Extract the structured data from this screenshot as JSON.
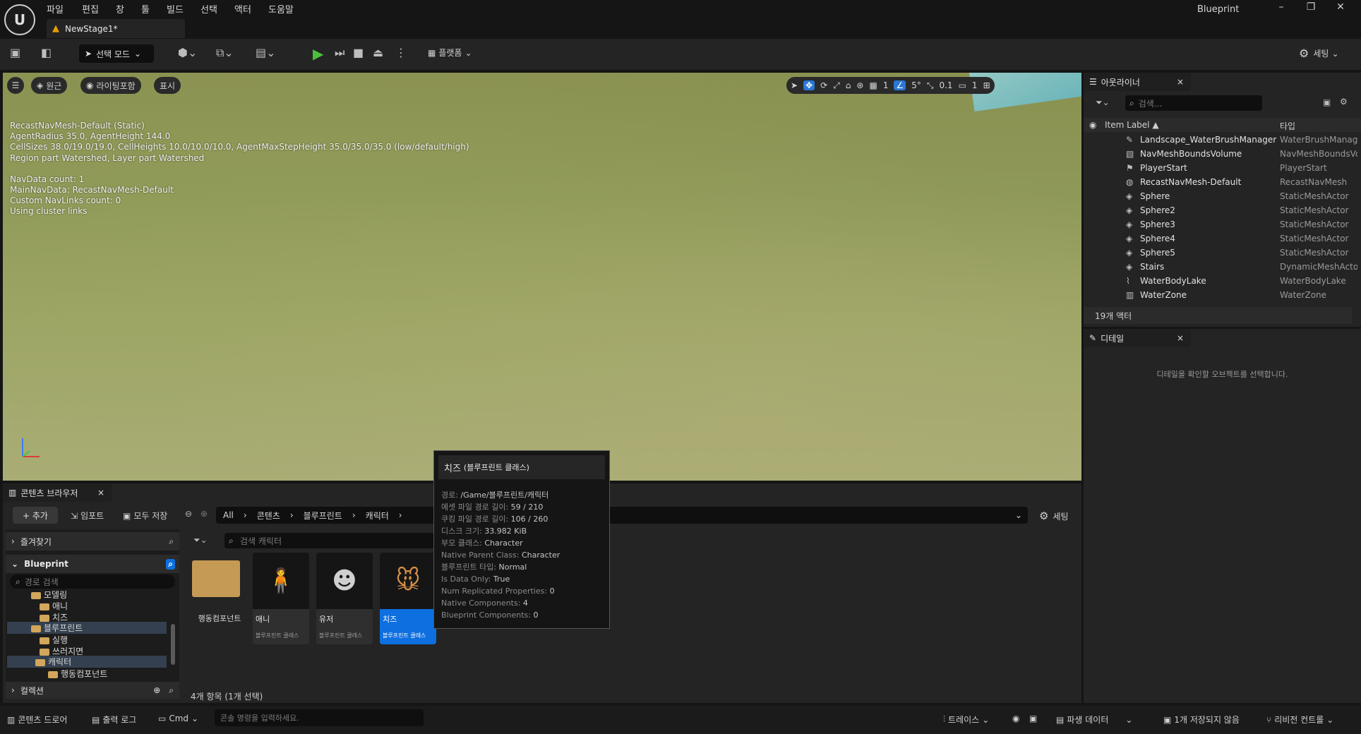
{
  "titlebar": {
    "menus": [
      "파일",
      "편집",
      "창",
      "툴",
      "빌드",
      "선택",
      "액터",
      "도움말"
    ],
    "app_name": "Blueprint",
    "minimize": "–",
    "restore": "❐",
    "close": "✕"
  },
  "tab": {
    "name": "NewStage1*"
  },
  "toolbar": {
    "mode_label": "선택 모드",
    "platform_label": "플랫폼",
    "settings_label": "세팅"
  },
  "viewport": {
    "perspective_label": "원근",
    "lighting_label": "라이팅포함",
    "show_label": "표시",
    "grid_value": "1",
    "angle_value": "5°",
    "scale_value": "0.1",
    "camera_value": "1",
    "navmesh_lines": [
      "RecastNavMesh-Default (Static)",
      "AgentRadius 35.0, AgentHeight 144.0",
      "CellSizes 38.0/19.0/19.0, CellHeights 10.0/10.0/10.0, AgentMaxStepHeight 35.0/35.0/35.0 (low/default/high)",
      "Region part Watershed, Layer part Watershed",
      "",
      "NavData count: 1",
      "MainNavData: RecastNavMesh-Default",
      "Custom NavLinks count: 0",
      "Using cluster links"
    ]
  },
  "outliner": {
    "tab_label": "아웃라이너",
    "search_placeholder": "검색...",
    "col_label": "Item Label ▲",
    "col_type": "타입",
    "rows": [
      {
        "label": "Landscape_WaterBrushManager",
        "type": "WaterBrushManager"
      },
      {
        "label": "NavMeshBoundsVolume",
        "type": "NavMeshBoundsVolume"
      },
      {
        "label": "PlayerStart",
        "type": "PlayerStart"
      },
      {
        "label": "RecastNavMesh-Default",
        "type": "RecastNavMesh"
      },
      {
        "label": "Sphere",
        "type": "StaticMeshActor"
      },
      {
        "label": "Sphere2",
        "type": "StaticMeshActor"
      },
      {
        "label": "Sphere3",
        "type": "StaticMeshActor"
      },
      {
        "label": "Sphere4",
        "type": "StaticMeshActor"
      },
      {
        "label": "Sphere5",
        "type": "StaticMeshActor"
      },
      {
        "label": "Stairs",
        "type": "DynamicMeshActor"
      },
      {
        "label": "WaterBodyLake",
        "type": "WaterBodyLake"
      },
      {
        "label": "WaterZone",
        "type": "WaterZone"
      }
    ],
    "count_label": "19개 액터"
  },
  "details": {
    "tab_label": "디테일",
    "empty_message": "디테일을 확인할 오브젝트를 선택합니다."
  },
  "content_browser": {
    "tab_label": "콘텐츠 브라우저",
    "add_label": "+ 추가",
    "import_label": "임포트",
    "save_all_label": "모두 저장",
    "path": [
      "All",
      "콘텐츠",
      "블루프린트",
      "캐릭터"
    ],
    "settings_label": "세팅",
    "favorites_label": "즐겨찾기",
    "project_label": "Blueprint",
    "path_search_placeholder": "경로 검색",
    "tree": [
      "모델링",
      "애니",
      "치즈",
      "블루프린트",
      "실행",
      "쓰러지면",
      "캐릭터",
      "행동컴포넌트"
    ],
    "collections_label": "컬렉션",
    "asset_search_placeholder": "검색 캐릭터",
    "folder_name": "행동컴포넌트",
    "assets": [
      {
        "name": "애니",
        "type": "블루프린트 클래스"
      },
      {
        "name": "유저",
        "type": "블루프린트 클래스"
      },
      {
        "name": "치즈",
        "type": "블루프린트 클래스"
      }
    ],
    "item_count": "4개 항목 (1개 선택)"
  },
  "tooltip": {
    "title": "치즈",
    "title_suffix": "(블루프린트 클래스)",
    "lines": [
      {
        "k": "경로:",
        "v": "/Game/블루프린트/캐릭터"
      },
      {
        "k": "에셋 파일 경로 길이:",
        "v": "59 / 210"
      },
      {
        "k": "쿠킹 파일 경로 길이:",
        "v": "106 / 260"
      },
      {
        "k": "디스크 크기:",
        "v": "33.982 KiB"
      },
      {
        "k": "부모 클래스:",
        "v": "Character"
      },
      {
        "k": "Native Parent Class:",
        "v": "Character"
      },
      {
        "k": "블루프린트 타입:",
        "v": "Normal"
      },
      {
        "k": "Is Data Only:",
        "v": "True"
      },
      {
        "k": "Num Replicated Properties:",
        "v": "0"
      },
      {
        "k": "Native Components:",
        "v": "4"
      },
      {
        "k": "Blueprint Components:",
        "v": "0"
      }
    ]
  },
  "statusbar": {
    "content_drawer": "콘텐츠 드로어",
    "output_log": "출력 로그",
    "cmd": "Cmd",
    "console_placeholder": "콘솔 명령을 입력하세요.",
    "trace": "트레이스",
    "derived_data": "파생 데이터",
    "unsaved": "1개 저장되지 않음",
    "revision": "리비전 컨트롤"
  }
}
